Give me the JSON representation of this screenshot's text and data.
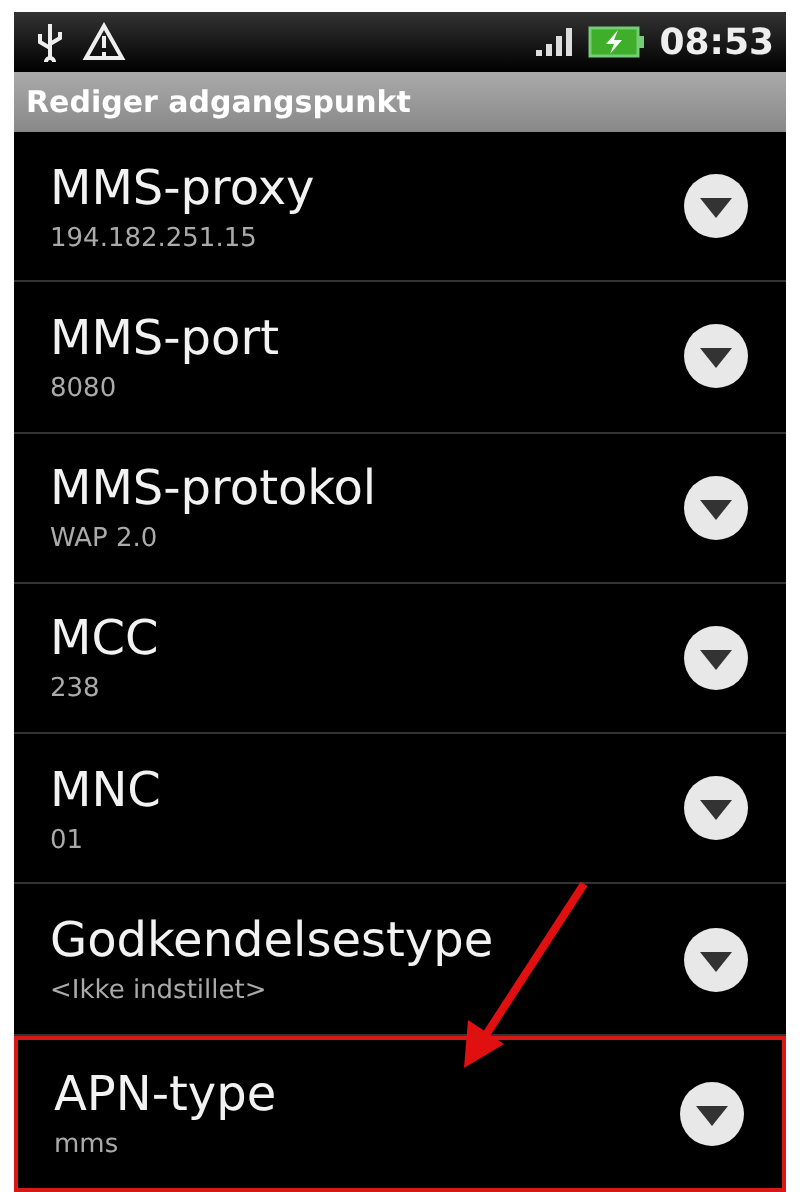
{
  "status_bar": {
    "time": "08:53"
  },
  "title_bar": {
    "title": "Rediger adgangspunkt"
  },
  "settings": [
    {
      "title": "MMS-proxy",
      "value": "194.182.251.15",
      "highlighted": false
    },
    {
      "title": "MMS-port",
      "value": "8080",
      "highlighted": false
    },
    {
      "title": "MMS-protokol",
      "value": "WAP 2.0",
      "highlighted": false
    },
    {
      "title": "MCC",
      "value": "238",
      "highlighted": false
    },
    {
      "title": "MNC",
      "value": "01",
      "highlighted": false
    },
    {
      "title": "Godkendelsestype",
      "value": "<Ikke indstillet>",
      "highlighted": false
    },
    {
      "title": "APN-type",
      "value": "mms",
      "highlighted": true
    }
  ]
}
